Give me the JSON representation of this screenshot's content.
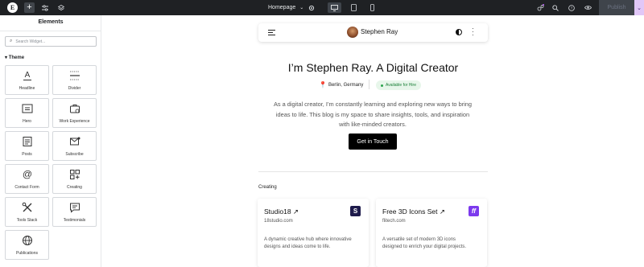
{
  "topbar": {
    "page_selector": "Homepage",
    "publish_label": "Publish",
    "colors": {
      "bar": "#1f2124",
      "accent": "#e1c7f7"
    }
  },
  "sidebar": {
    "title": "Elements",
    "search_placeholder": "Search Widget...",
    "category": "Theme",
    "widgets": [
      {
        "label": "Headline",
        "icon": "headline-icon"
      },
      {
        "label": "Divider",
        "icon": "divider-icon"
      },
      {
        "label": "Hero",
        "icon": "hero-icon"
      },
      {
        "label": "Work Experience",
        "icon": "briefcase-icon"
      },
      {
        "label": "Posts",
        "icon": "posts-icon"
      },
      {
        "label": "Subscribe",
        "icon": "subscribe-icon"
      },
      {
        "label": "Contact Form",
        "icon": "at-icon"
      },
      {
        "label": "Creating",
        "icon": "creating-icon"
      },
      {
        "label": "Tools Stack",
        "icon": "tools-icon"
      },
      {
        "label": "Testimonials",
        "icon": "testimonials-icon"
      },
      {
        "label": "Publications",
        "icon": "globe-icon"
      }
    ]
  },
  "preview": {
    "nav_name": "Stephen Ray",
    "hero_title": "I’m Stephen Ray. A Digital Creator",
    "location": "Berlin, Germany",
    "availability": "Available for Hire",
    "description": "As a digital creator, I’m constantly learning and exploring new ways to bring ideas to life. This blog is my space to share insights, tools, and inspiration with like-minded creators.",
    "cta_label": "Get in Touch",
    "section_label": "Creating",
    "cards": [
      {
        "title": "Studio18 ↗",
        "url": "18studio.com",
        "logo_letter": "S",
        "logo_color": "#1e1b4b",
        "description": "A dynamic creative hub where innovative designs and ideas come to life."
      },
      {
        "title": "Free 3D Icons Set ↗",
        "url": "flitech.com",
        "logo_letter": "ff",
        "logo_color": "#7c3aed",
        "description": "A versatile set of modern 3D icons designed to enrich your digital projects."
      }
    ]
  }
}
